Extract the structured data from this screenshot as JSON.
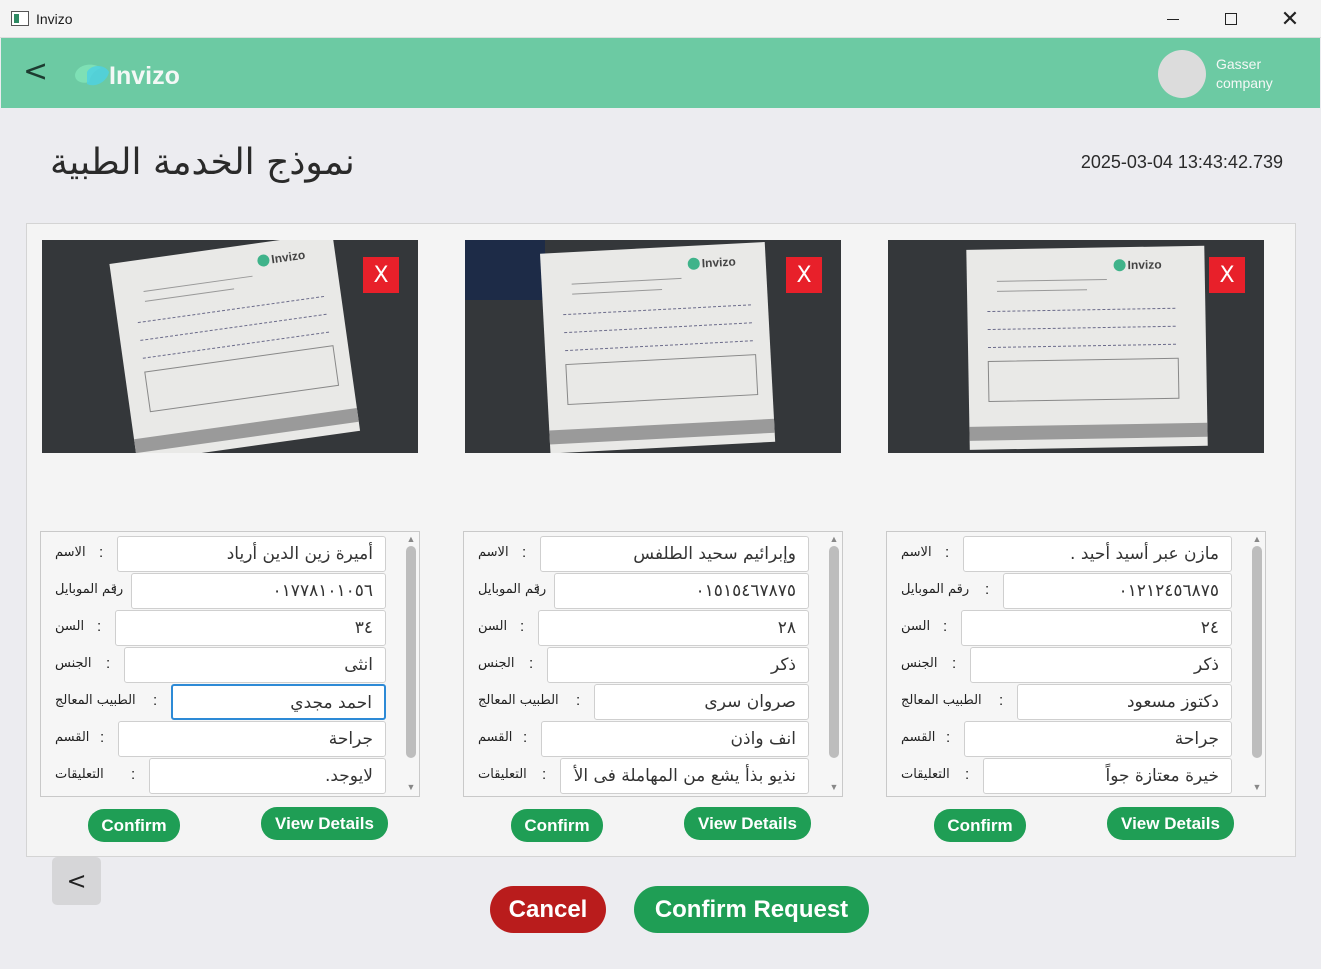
{
  "window": {
    "title": "Invizo"
  },
  "header": {
    "brand": "Invizo",
    "user_line1": "Gasser",
    "user_line2": "company"
  },
  "page": {
    "title": "نموذج الخدمة الطبية",
    "timestamp": "2025-03-04 13:43:42.739"
  },
  "cards": [
    {
      "remove_label": "X",
      "photo_logo": "Invizo",
      "fields": [
        {
          "label": "الاسم",
          "value": "أميرة زين الدين أرياد"
        },
        {
          "label": "رقم الموبايل",
          "value": "٠١٧٧٨١٠١٠٥٦"
        },
        {
          "label": "السن",
          "value": "٣٤"
        },
        {
          "label": "الجنس",
          "value": "انثى"
        },
        {
          "label": "الطبيب المعالج",
          "value": "احمد مجدي"
        },
        {
          "label": "القسم",
          "value": "جراحة"
        },
        {
          "label": "التعليقات",
          "value": "لايوجد."
        }
      ],
      "confirm_label": "Confirm",
      "details_label": "View Details"
    },
    {
      "remove_label": "X",
      "photo_logo": "Invizo",
      "fields": [
        {
          "label": "الاسم",
          "value": "وإبرائيم سحيد الطلفس"
        },
        {
          "label": "رقم الموبايل",
          "value": "٠١٥١٥٤٦٧٨٧٥"
        },
        {
          "label": "السن",
          "value": "٢٨"
        },
        {
          "label": "الجنس",
          "value": "ذكر"
        },
        {
          "label": "الطبيب المعالج",
          "value": "صروان سرى"
        },
        {
          "label": "القسم",
          "value": "انف واذن"
        },
        {
          "label": "التعليقات",
          "value": "نذيو بذأ يشع من المهاملة فى الأ"
        }
      ],
      "confirm_label": "Confirm",
      "details_label": "View Details"
    },
    {
      "remove_label": "X",
      "photo_logo": "Invizo",
      "fields": [
        {
          "label": "الاسم",
          "value": "مازن عبر أسيد أحيد ."
        },
        {
          "label": "رقم الموبايل",
          "value": "٠١٢١٢٤٥٦٨٧٥"
        },
        {
          "label": "السن",
          "value": "٢٤"
        },
        {
          "label": "الجنس",
          "value": "ذكر"
        },
        {
          "label": "الطبيب المعالج",
          "value": "دكتوز مسعود"
        },
        {
          "label": "القسم",
          "value": "جراحة"
        },
        {
          "label": "التعليقات",
          "value": "خيرة معتازة جواً"
        }
      ],
      "confirm_label": "Confirm",
      "details_label": "View Details"
    }
  ],
  "footer": {
    "prev_label": "<",
    "cancel_label": "Cancel",
    "confirm_request_label": "Confirm Request"
  },
  "nav": {
    "back_label": "<"
  },
  "colors": {
    "header": "#6ccaa3",
    "green": "#1f9e55",
    "red": "#b91c1c",
    "remove": "#e8202a"
  }
}
